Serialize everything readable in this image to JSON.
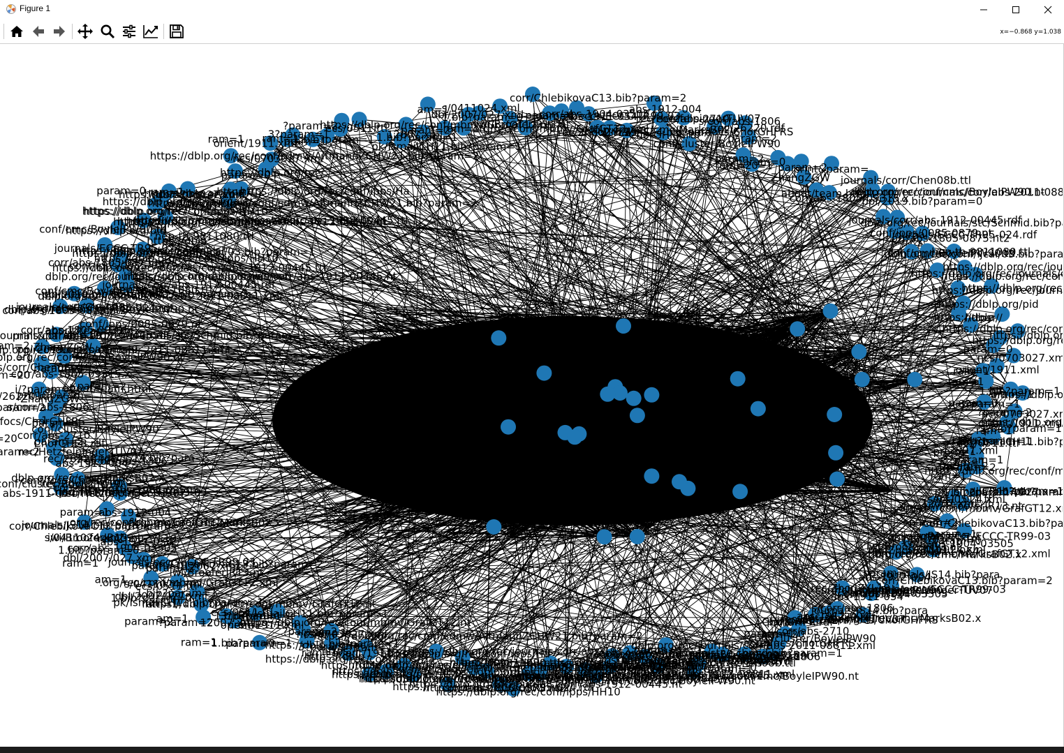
{
  "window": {
    "title": "Figure 1"
  },
  "window_controls": {
    "minimize": "minimize",
    "maximize": "maximize",
    "close": "close"
  },
  "toolbar": {
    "buttons": [
      "home-icon",
      "back-arrow-icon",
      "forward-arrow-icon",
      "pan-icon",
      "zoom-icon",
      "subplots-icon",
      "edit-axes-icon",
      "save-icon"
    ],
    "coords": "x=−0.868 y=1.038"
  },
  "colors": {
    "node": "#1f77b4",
    "edge": "#000000",
    "label": "#000000"
  },
  "graph": {
    "type": "networkx directed graph, circular layout",
    "node_labels": [
      "https://dblp.org/rec/conf/sdmw/AltmannZCHW21.bib?param=2",
      "param=0",
      "ncs/0703027.xml",
      "orient/1911.xml",
      "ram=1",
      "ram=1",
      "1.bib?param=1",
      "pram=1",
      "3?param=1",
      "?param=2",
      "https://dblp.org/rec/conf/mbmv/GrafGT12.nt",
      "1.bib?param=1",
      "pk/IsmailCH11.bib?param=1",
      "ecs/0511.ttl",
      "12007.xml",
      "am=1",
      "param=2",
      "ram=1",
      "dbl/2007/027.xml",
      "1.bib?param=0",
      "s/0411024.xml",
      "iwi/BrooferJR13.nt",
      ".org/rec/conf/mbmv/GrafGT12.xml",
      "corr/ChlebikovaC13.bib?param=2",
      "param=1",
      "journals/eccc/ECCC-TR99-03",
      "corr/abs-1904-03505",
      "abs-1911-054",
      "rec/ZhouZYL19.",
      "dblp.org/rec/cmc/MarksB02.x",
      "journals/JS14.bib?para",
      "abs-1912-004",
      "rec/HetzfelpingerTUV07",
      "ChorGHFR.rdf",
      "corr/abs-2710",
      "conf/cluster/BoyleIPW90",
      "conf/focs/ChorGHFRS",
      "s/corr/abs-1806",
      "rec/26220.rdf",
      "i/?param=2",
      "param=2",
      "ram=20",
      "param=0",
      "=1",
      "param=2",
      "ZhangZGW",
      "print&param=",
      "about/team.html",
      "corr/abs-1805-09315.x",
      "journals/corr/Chen08b.ttl",
      "dblp.org/rec/conf/cmc/BoyleIPW90.nt",
      "dblp.org/rec/journals/corr/abs-2011-08811.xml",
      "ppi/2019.bib?param=0",
      "journals/corr/abs-1912-00445.rdf",
      "dblp.org/rec/journals/stc/Schmid.bib?param=1",
      "conf/ipps/0085-0879.nt",
      "corr/abs-1805-0875.nt2",
      "journals/ECCC-TR95-024.rdf",
      "dblp.org/rec/conf/ijcai/03.bib?param=1",
      "conf/cmc/BoyleIPW90.ttl",
      "hep-th-9811080.ttl",
      "https://dblp.org/rec/journals/corr/abs-1912-00445.nt",
      "https://dblp.org/rec/journals/corr/abs-1912-00445.ttl",
      "https://dblp.org/rec/conf/ipps/HH10",
      "https://dblp.org/rec/journals/",
      "https://dblp.org/rec/conf/",
      "https://dblp.org/pid",
      "https://dblp",
      "https://",
      "https://dblp.org/rec/conf/ipps/Ha",
      "https://dblp.org/rec/"
    ]
  }
}
